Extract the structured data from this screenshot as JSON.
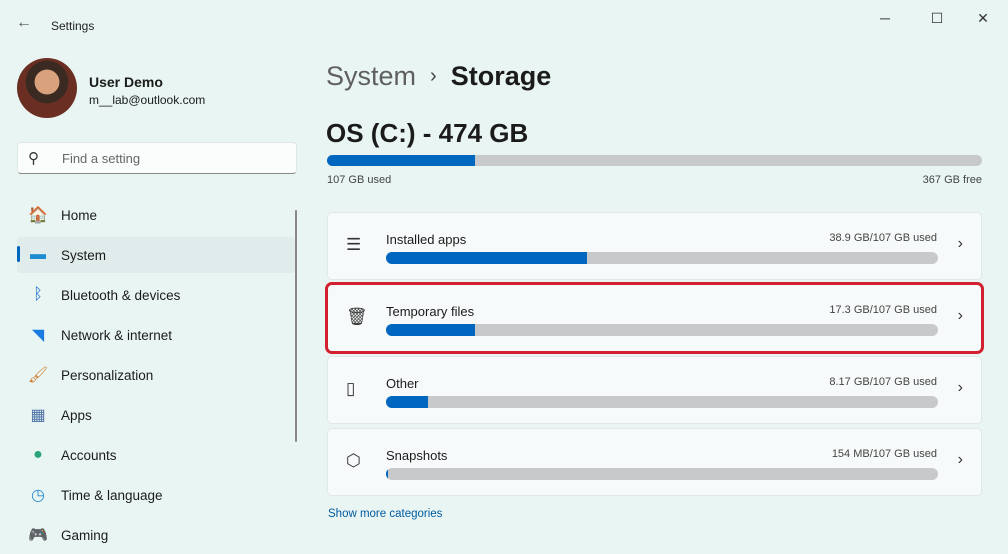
{
  "window": {
    "title": "Settings"
  },
  "user": {
    "name": "User Demo",
    "email": "m__lab@outlook.com"
  },
  "search": {
    "placeholder": "Find a setting"
  },
  "nav": [
    {
      "label": "Home",
      "icon": "home-icon"
    },
    {
      "label": "System",
      "icon": "system-icon",
      "selected": true
    },
    {
      "label": "Bluetooth & devices",
      "icon": "bluetooth-icon"
    },
    {
      "label": "Network & internet",
      "icon": "wifi-icon"
    },
    {
      "label": "Personalization",
      "icon": "brush-icon"
    },
    {
      "label": "Apps",
      "icon": "apps-icon"
    },
    {
      "label": "Accounts",
      "icon": "accounts-icon"
    },
    {
      "label": "Time & language",
      "icon": "clock-icon"
    },
    {
      "label": "Gaming",
      "icon": "gamepad-icon"
    }
  ],
  "breadcrumb": {
    "parent": "System",
    "separator": "›",
    "current": "Storage"
  },
  "drive": {
    "title": "OS (C:) - 474 GB",
    "used_label": "107 GB used",
    "free_label": "367 GB free",
    "used_percent": 22.6
  },
  "categories": [
    {
      "name": "Installed apps",
      "usage": "38.9 GB/107 GB used",
      "percent": 36.4,
      "icon": "list-icon"
    },
    {
      "name": "Temporary files",
      "usage": "17.3 GB/107 GB used",
      "percent": 16.2,
      "icon": "trash-icon",
      "highlighted": true
    },
    {
      "name": "Other",
      "usage": "8.17 GB/107 GB used",
      "percent": 7.6,
      "icon": "document-icon"
    },
    {
      "name": "Snapshots",
      "usage": "154 MB/107 GB used",
      "percent": 0.2,
      "icon": "snapshot-icon"
    }
  ],
  "show_more": "Show more categories",
  "colors": {
    "accent": "#0067c0",
    "highlight": "#d3202f",
    "background": "#e9f5f3"
  }
}
